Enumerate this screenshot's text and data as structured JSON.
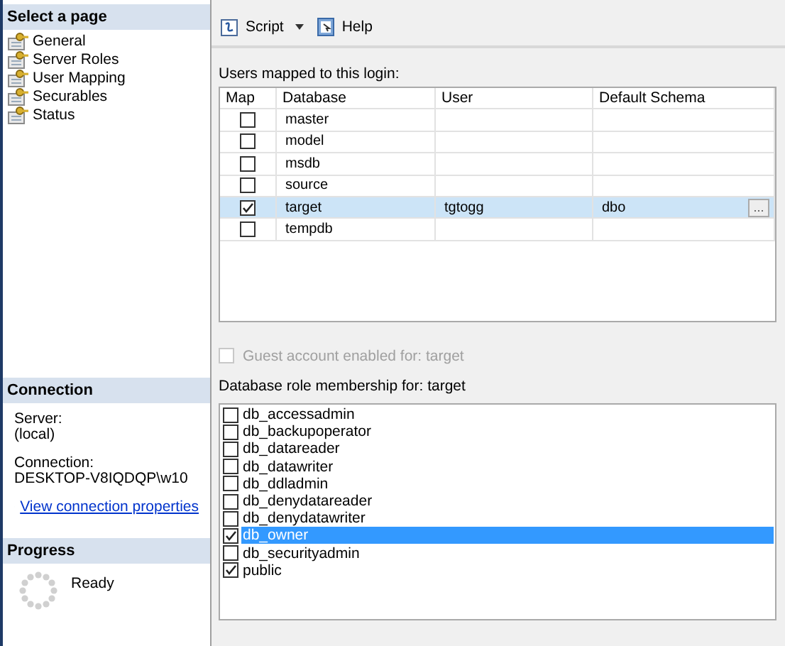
{
  "sidebar": {
    "title": "Select a page",
    "items": [
      {
        "label": "General"
      },
      {
        "label": "Server Roles"
      },
      {
        "label": "User Mapping"
      },
      {
        "label": "Securables"
      },
      {
        "label": "Status"
      }
    ]
  },
  "connection": {
    "title": "Connection",
    "server_label": "Server:",
    "server": "(local)",
    "connection_label": "Connection:",
    "connection": "DESKTOP-V8IQDQP\\w10",
    "link": "View connection properties"
  },
  "progress": {
    "title": "Progress",
    "status": "Ready"
  },
  "toolbar": {
    "script": "Script",
    "help": "Help"
  },
  "users_mapped": {
    "label": "Users mapped to this login:",
    "columns": [
      "Map",
      "Database",
      "User",
      "Default Schema"
    ],
    "rows": [
      {
        "map": false,
        "database": "master",
        "selected": false
      },
      {
        "map": false,
        "database": "model",
        "selected": false
      },
      {
        "map": false,
        "database": "msdb",
        "selected": false
      },
      {
        "map": false,
        "database": "source",
        "selected": false
      },
      {
        "map": true,
        "database": "target",
        "user": "tgtogg",
        "schema": "dbo",
        "browse_button": "...",
        "selected": true
      },
      {
        "map": false,
        "database": "tempdb",
        "selected": false
      }
    ]
  },
  "guest": {
    "label": "Guest account enabled for: target",
    "checked": false,
    "disabled": true
  },
  "roles": {
    "label": "Database role membership for: target",
    "items": [
      {
        "name": "db_accessadmin",
        "checked": false,
        "selected": false
      },
      {
        "name": "db_backupoperator",
        "checked": false,
        "selected": false
      },
      {
        "name": "db_datareader",
        "checked": false,
        "selected": false
      },
      {
        "name": "db_datawriter",
        "checked": false,
        "selected": false
      },
      {
        "name": "db_ddladmin",
        "checked": false,
        "selected": false
      },
      {
        "name": "db_denydatareader",
        "checked": false,
        "selected": false
      },
      {
        "name": "db_denydatawriter",
        "checked": false,
        "selected": false
      },
      {
        "name": "db_owner",
        "checked": true,
        "selected": true
      },
      {
        "name": "db_securityadmin",
        "checked": false,
        "selected": false
      },
      {
        "name": "public",
        "checked": true,
        "selected": false
      }
    ]
  }
}
